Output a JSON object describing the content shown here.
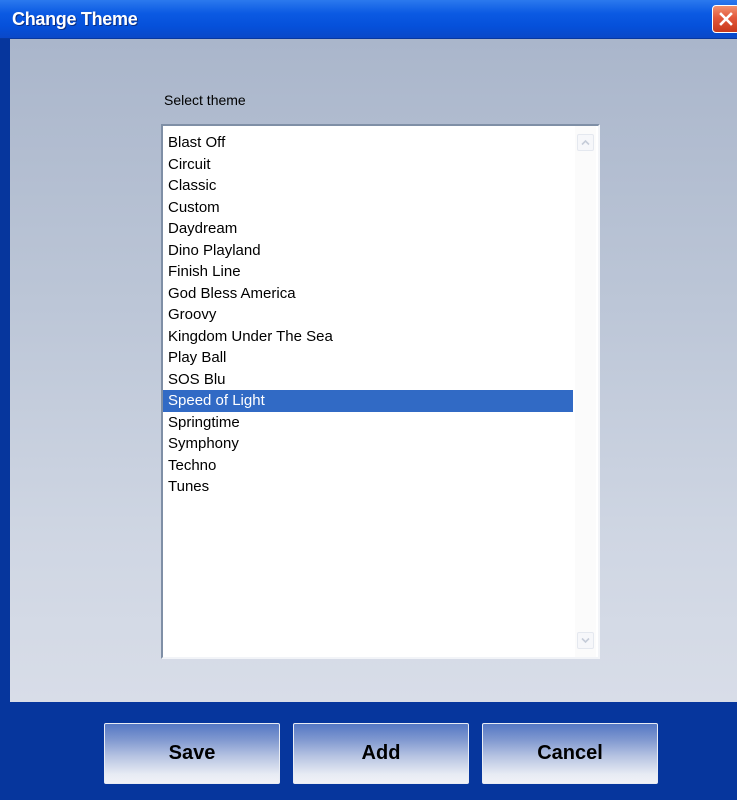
{
  "window": {
    "title": "Change Theme",
    "close_icon": "close-icon"
  },
  "theme_picker": {
    "label": "Select theme",
    "items": [
      "Blast Off",
      "Circuit",
      "Classic",
      "Custom",
      "Daydream",
      "Dino Playland",
      "Finish Line",
      "God Bless America",
      "Groovy",
      "Kingdom Under The Sea",
      "Play Ball",
      "SOS Blu",
      "Speed of Light",
      "Springtime",
      "Symphony",
      "Techno",
      "Tunes"
    ],
    "selected": "Speed of Light"
  },
  "buttons": {
    "save": "Save",
    "add": "Add",
    "cancel": "Cancel"
  },
  "colors": {
    "titlebar": "#0b5ae3",
    "selection": "#316ac5",
    "frame": "#06369d",
    "close_button": "#e2583b"
  }
}
